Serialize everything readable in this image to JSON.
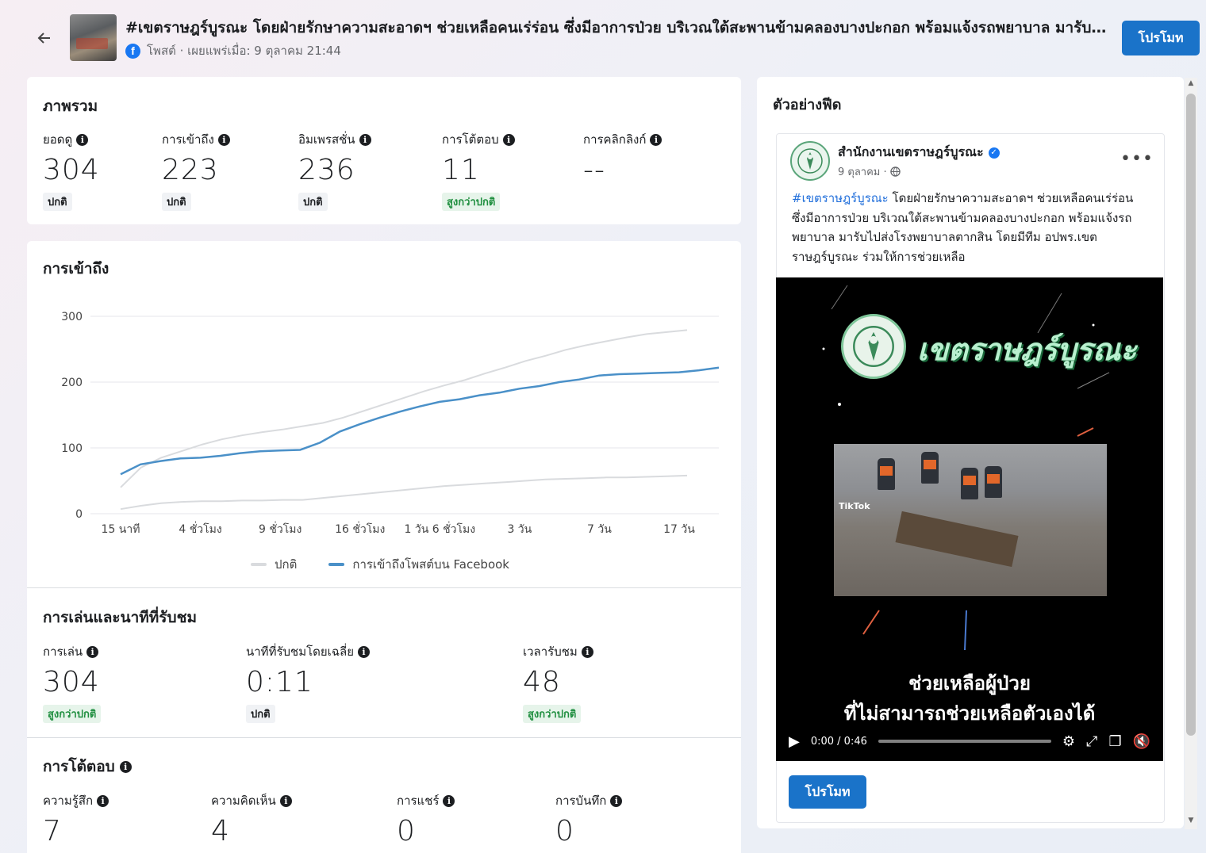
{
  "header": {
    "title": "#เขตราษฎร์บูรณะ โดยฝ่ายรักษาความสะอาดฯ ช่วยเหลือคนเร่ร่อน ซึ่งมีอาการป่วย บริเวณใต้สะพานข้ามคลองบางปะกอก พร้อมแจ้งรถพยาบาล มารับไปส่งโรงพยาบาลตากสิน",
    "subtitle": "โพสต์ · เผยแพร่เมื่อ: 9 ตุลาคม 21:44",
    "promote_label": "โปรโมท"
  },
  "overview": {
    "title": "ภาพรวม",
    "metrics": [
      {
        "label": "ยอดดู",
        "value": "304",
        "badge": "ปกติ"
      },
      {
        "label": "การเข้าถึง",
        "value": "223",
        "badge": "ปกติ"
      },
      {
        "label": "อิมเพรสชั่น",
        "value": "236",
        "badge": "ปกติ"
      },
      {
        "label": "การโต้ตอบ",
        "value": "11",
        "badge": "สูงกว่าปกติ"
      },
      {
        "label": "การคลิกลิงก์",
        "value": "--",
        "badge": ""
      }
    ]
  },
  "reach": {
    "title": "การเข้าถึง",
    "legend_normal": "ปกติ",
    "legend_series": "การเข้าถึงโพสต์บน Facebook"
  },
  "chart_data": {
    "type": "line",
    "title": "การเข้าถึง",
    "x_labels": [
      "15 นาที",
      "4 ชั่วโมง",
      "9 ชั่วโมง",
      "16 ชั่วโมง",
      "1 วัน 6 ชั่วโมง",
      "3 วัน",
      "7 วัน",
      "17 วัน"
    ],
    "y_ticks": [
      0,
      100,
      200,
      300
    ],
    "ylim": [
      0,
      300
    ],
    "grid": true,
    "legend": "bottom",
    "series": [
      {
        "name": "ปกติ",
        "role": "normal_upper",
        "color": "#d9dbde",
        "values": [
          40,
          70,
          85,
          95,
          105,
          113,
          119,
          124,
          128,
          133,
          138,
          146,
          156,
          166,
          176,
          186,
          195,
          203,
          213,
          222,
          232,
          240,
          249,
          256,
          262,
          268,
          273,
          276,
          279
        ]
      },
      {
        "name": "ปกติ",
        "role": "normal_lower",
        "color": "#d9dbde",
        "values": [
          7,
          12,
          16,
          18,
          19,
          19,
          20,
          20,
          21,
          21,
          24,
          27,
          30,
          33,
          36,
          39,
          42,
          44,
          46,
          48,
          50,
          52,
          53,
          54,
          55,
          55,
          56,
          57,
          58
        ]
      },
      {
        "name": "การเข้าถึงโพสต์บน Facebook",
        "role": "actual",
        "color": "#4a90c8",
        "values": [
          60,
          75,
          80,
          84,
          85,
          88,
          92,
          95,
          96,
          97,
          108,
          125,
          136,
          146,
          155,
          163,
          170,
          174,
          180,
          184,
          190,
          194,
          200,
          204,
          210,
          212,
          213,
          214,
          215,
          218,
          222
        ]
      }
    ]
  },
  "playback": {
    "title": "การเล่นและนาทีที่รับชม",
    "metrics": [
      {
        "label": "การเล่น",
        "value": "304",
        "badge": "สูงกว่าปกติ"
      },
      {
        "label": "นาทีที่รับชมโดยเฉลี่ย",
        "value": "0:11",
        "badge": "ปกติ"
      },
      {
        "label": "เวลารับชม",
        "value": "48",
        "badge": "สูงกว่าปกติ"
      }
    ]
  },
  "interactions": {
    "title": "การโต้ตอบ",
    "metrics": [
      {
        "label": "ความรู้สึก",
        "value": "7"
      },
      {
        "label": "ความคิดเห็น",
        "value": "4"
      },
      {
        "label": "การแชร์",
        "value": "0"
      },
      {
        "label": "การบันทึก",
        "value": "0"
      }
    ]
  },
  "preview": {
    "title": "ตัวอย่างฟีด",
    "page_name": "สำนักงานเขตราษฎร์บูรณะ",
    "date": "9 ตุลาคม ·",
    "hashtag": "#เขตราษฎร์บูรณะ",
    "text": " โดยฝ่ายรักษาความสะอาดฯ ช่วยเหลือคนเร่ร่อน ซึ่งมีอาการป่วย บริเวณใต้สะพานข้ามคลองบางปะกอก พร้อมแจ้งรถพยาบาล มารับไปส่งโรงพยาบาลตากสิน โดยมีทีม อปพร.เขตราษฎร์บูรณะ ร่วมให้การช่วยเหลือ",
    "video_brand": "เขตราษฎร์บูรณะ",
    "video_caption1": "ช่วยเหลือผู้ป่วย",
    "video_caption2": "ที่ไม่สามารถช่วยเหลือตัวเองได้",
    "tiktok": "TikTok",
    "video_time": "0:00 / 0:46",
    "promote_label": "โปรโมท"
  }
}
